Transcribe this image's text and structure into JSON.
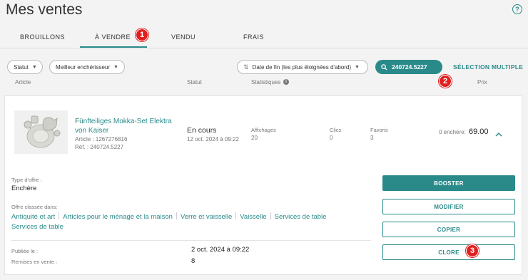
{
  "page": {
    "title": "Mes ventes",
    "help": "?"
  },
  "tabs": [
    {
      "label": "BROUILLONS"
    },
    {
      "label": "À VENDRE"
    },
    {
      "label": "VENDU"
    },
    {
      "label": "FRAIS"
    }
  ],
  "annotations": {
    "one": "1",
    "two": "2",
    "three": "3"
  },
  "filters": {
    "statut": "Statut",
    "bidder": "Meilleur enchérisseur",
    "sort": "Date de fin (les plus éloignées d'abord)",
    "search_value": "240724.5227",
    "multi_select": "SÉLECTION MULTIPLE"
  },
  "columns": {
    "article": "Article",
    "statut": "Statut",
    "stats": "Statistiques",
    "prix": "Prix"
  },
  "item": {
    "title": "Fünfteiliges Mokka-Set Elektra von Kaiser",
    "article": "Article : 1267276816",
    "ref": "Réf. : 240724.5227",
    "status": "En cours",
    "status_date": "12 oct. 2024 à 09:22",
    "views_label": "Affichages",
    "views": "20",
    "clicks_label": "Clics",
    "clicks": "0",
    "favs_label": "Favoris",
    "favs": "3",
    "bids": "0 enchère:",
    "price": "69.00"
  },
  "details": {
    "offer_type_label": "Type d'offre :",
    "offer_type": "Enchère",
    "category_label": "Offre classée dans:",
    "categories": [
      "Antiquité et art",
      "Articles pour le ménage et la maison",
      "Verre et vaisselle",
      "Vaisselle",
      "Services de table",
      "Services de table"
    ],
    "published_label": "Publiée le :",
    "published": "2 oct. 2024 à 09:22",
    "relist_label": "Remises en vente :",
    "relist": "8"
  },
  "actions": {
    "booster": "BOOSTER",
    "modifier": "MODIFIER",
    "copier": "COPIER",
    "clore": "CLORE"
  },
  "colors": {
    "accent": "#2a8a8a",
    "badge": "#e02020"
  },
  "icons": [
    "help-icon",
    "chevron-down-icon",
    "sort-icon",
    "search-icon",
    "close-icon",
    "info-icon",
    "chevron-up-icon"
  ]
}
